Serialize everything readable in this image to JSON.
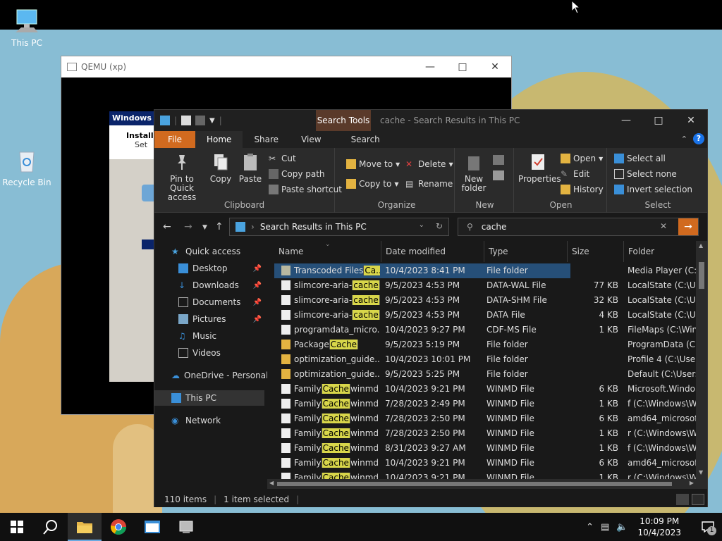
{
  "desktop": {
    "icons": [
      {
        "label": "This PC"
      },
      {
        "label": "Recycle Bin"
      }
    ]
  },
  "qemu": {
    "title": "QEMU (xp)",
    "guest_title": "Windows X",
    "guest_text1": "Installi",
    "guest_text2": "Set"
  },
  "explorer": {
    "context_tab": "Search Tools",
    "title": "cache - Search Results in This PC",
    "tabs": [
      "File",
      "Home",
      "Share",
      "View",
      "Search"
    ],
    "ribbon": {
      "clipboard": {
        "label": "Clipboard",
        "pin": "Pin to Quick access",
        "copy": "Copy",
        "paste": "Paste",
        "cut": "Cut",
        "copy_path": "Copy path",
        "paste_shortcut": "Paste shortcut"
      },
      "organize": {
        "label": "Organize",
        "move_to": "Move to",
        "copy_to": "Copy to",
        "delete": "Delete",
        "rename": "Rename"
      },
      "new": {
        "label": "New",
        "new_folder": "New folder"
      },
      "open": {
        "label": "Open",
        "properties": "Properties",
        "open": "Open",
        "edit": "Edit",
        "history": "History"
      },
      "select": {
        "label": "Select",
        "select_all": "Select all",
        "select_none": "Select none",
        "invert": "Invert selection"
      }
    },
    "address": "Search Results in This PC",
    "search_value": "cache",
    "nav": [
      {
        "label": "Quick access"
      },
      {
        "label": "Desktop"
      },
      {
        "label": "Downloads"
      },
      {
        "label": "Documents"
      },
      {
        "label": "Pictures"
      },
      {
        "label": "Music"
      },
      {
        "label": "Videos"
      },
      {
        "label": "OneDrive - Personal"
      },
      {
        "label": "This PC"
      },
      {
        "label": "Network"
      }
    ],
    "columns": [
      "Name",
      "Date modified",
      "Type",
      "Size",
      "Folder"
    ],
    "rows": [
      {
        "pre": "Transcoded Files",
        "hl": "Ca...",
        "post": "",
        "date": "10/4/2023 8:41 PM",
        "type": "File folder",
        "size": "",
        "folder": "Media Player (C:\\...",
        "kind": "folder"
      },
      {
        "pre": "slimcore-aria-",
        "hl": "cache",
        "post": "...",
        "date": "9/5/2023 4:53 PM",
        "type": "DATA-WAL File",
        "size": "77 KB",
        "folder": "LocalState (C:\\Use",
        "kind": "file"
      },
      {
        "pre": "slimcore-aria-",
        "hl": "cache",
        "post": "...",
        "date": "9/5/2023 4:53 PM",
        "type": "DATA-SHM File",
        "size": "32 KB",
        "folder": "LocalState (C:\\Use",
        "kind": "file"
      },
      {
        "pre": "slimcore-aria-",
        "hl": "cache",
        "post": "...",
        "date": "9/5/2023 4:53 PM",
        "type": "DATA File",
        "size": "4 KB",
        "folder": "LocalState (C:\\Use",
        "kind": "file"
      },
      {
        "pre": "programdata_micro...",
        "hl": "",
        "post": "",
        "date": "10/4/2023 9:27 PM",
        "type": "CDF-MS File",
        "size": "1 KB",
        "folder": "FileMaps (C:\\Win...",
        "kind": "file"
      },
      {
        "pre": "Package",
        "hl": "Cache",
        "post": "",
        "date": "9/5/2023 5:19 PM",
        "type": "File folder",
        "size": "",
        "folder": "ProgramData (C:)",
        "kind": "folder"
      },
      {
        "pre": "optimization_guide...",
        "hl": "",
        "post": "",
        "date": "10/4/2023 10:01 PM",
        "type": "File folder",
        "size": "",
        "folder": "Profile 4 (C:\\Users...",
        "kind": "folder"
      },
      {
        "pre": "optimization_guide...",
        "hl": "",
        "post": "",
        "date": "9/5/2023 5:25 PM",
        "type": "File folder",
        "size": "",
        "folder": "Default (C:\\Users\\...",
        "kind": "folder"
      },
      {
        "pre": "Family",
        "hl": "Cache",
        "post": "winmd",
        "date": "10/4/2023 9:21 PM",
        "type": "WINMD File",
        "size": "6 KB",
        "folder": "Microsoft.Windo...",
        "kind": "file"
      },
      {
        "pre": "Family",
        "hl": "Cache",
        "post": "winmd",
        "date": "7/28/2023 2:49 PM",
        "type": "WINMD File",
        "size": "1 KB",
        "folder": "f (C:\\Windows\\Wi...",
        "kind": "file"
      },
      {
        "pre": "Family",
        "hl": "Cache",
        "post": "winmd",
        "date": "7/28/2023 2:50 PM",
        "type": "WINMD File",
        "size": "6 KB",
        "folder": "amd64_microsoft-...",
        "kind": "file"
      },
      {
        "pre": "Family",
        "hl": "Cache",
        "post": "winmd",
        "date": "7/28/2023 2:50 PM",
        "type": "WINMD File",
        "size": "1 KB",
        "folder": "r (C:\\Windows\\Wi...",
        "kind": "file"
      },
      {
        "pre": "Family",
        "hl": "Cache",
        "post": "winmd",
        "date": "8/31/2023 9:27 AM",
        "type": "WINMD File",
        "size": "1 KB",
        "folder": "f (C:\\Windows\\Wi...",
        "kind": "file"
      },
      {
        "pre": "Family",
        "hl": "Cache",
        "post": "winmd",
        "date": "10/4/2023 9:21 PM",
        "type": "WINMD File",
        "size": "6 KB",
        "folder": "amd64_microsoft-...",
        "kind": "file"
      },
      {
        "pre": "Family",
        "hl": "Cache",
        "post": "winmd",
        "date": "10/4/2023 9:21 PM",
        "type": "WINMD File",
        "size": "1 KB",
        "folder": "r (C:\\Windows\\Wi...",
        "kind": "file"
      }
    ],
    "status": {
      "items": "110 items",
      "selected": "1 item selected"
    }
  },
  "taskbar": {
    "time": "10:09 PM",
    "date": "10/4/2023",
    "notif_count": "1"
  },
  "colors": {
    "accent": "#d16a1f",
    "selection": "#264f78",
    "highlight": "#d8d64a"
  }
}
